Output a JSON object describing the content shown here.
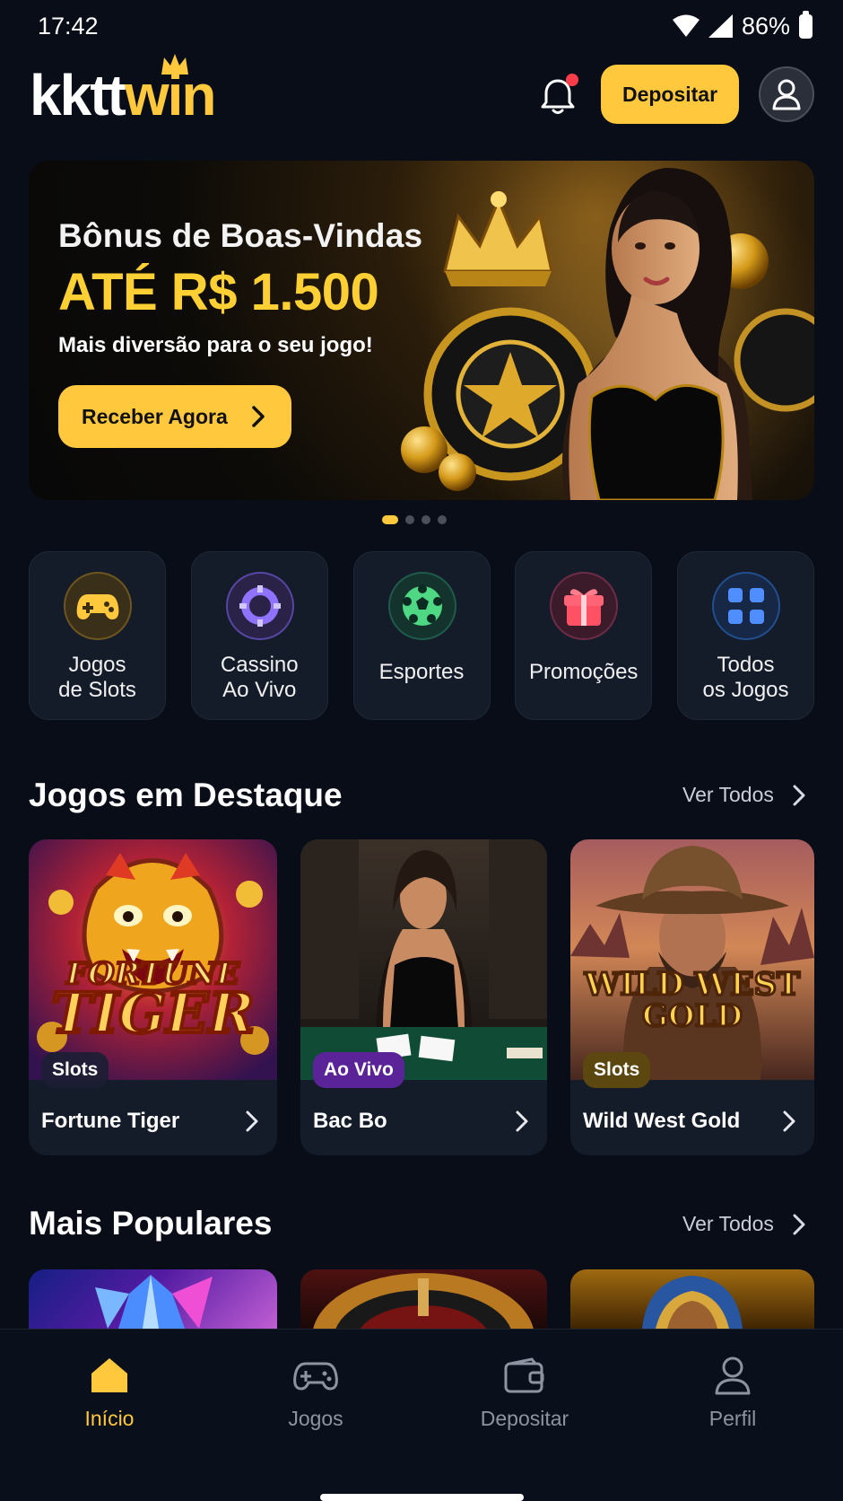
{
  "status_bar": {
    "time": "17:42",
    "battery": "86%"
  },
  "header": {
    "logo_white": "kktt",
    "logo_gold": "win",
    "deposit_label": "Depositar",
    "icons": [
      "bell-icon",
      "user-icon"
    ]
  },
  "banner": {
    "title": "Bônus de Boas-Vindas",
    "amount": "ATÉ R$ 1.500",
    "subtitle": "Mais diversão para o seu jogo!",
    "cta_label": "Receber Agora",
    "slide_count": 4,
    "active_slide": 1
  },
  "quick_links": [
    {
      "line1": "Jogos",
      "line2": "de Slots",
      "icon": "gamepad-icon"
    },
    {
      "line1": "Cassino",
      "line2": "Ao Vivo",
      "icon": "casino-chip-icon"
    },
    {
      "line1": "Esportes",
      "icon": "soccer-ball-icon"
    },
    {
      "line1": "Promoções",
      "icon": "gift-icon"
    },
    {
      "line1": "Todos",
      "line2": "os Jogos",
      "icon": "grid-icon"
    }
  ],
  "featured": {
    "title": "Jogos em Destaque",
    "see_all_label": "Ver Todos",
    "games": [
      {
        "art_title_1": "FORTUNE",
        "art_title_2": "TIGER",
        "tag": "Slots",
        "name": "Fortune Tiger"
      },
      {
        "tag": "Ao Vivo",
        "name": "Bac Bo"
      },
      {
        "art_title_1": "WILD WEST",
        "art_title_2": "GOLD",
        "tag": "Slots",
        "name": "Wild West Gold"
      }
    ]
  },
  "popular": {
    "title": "Mais Populares",
    "see_all_label": "Ver Todos"
  },
  "bottom_nav": {
    "items": [
      {
        "label": "Início",
        "icon": "home-icon",
        "active": true
      },
      {
        "label": "Jogos",
        "icon": "gamepad-icon",
        "active": false
      },
      {
        "label": "Depositar",
        "icon": "wallet-icon",
        "active": false
      },
      {
        "label": "Perfil",
        "icon": "user-icon",
        "active": false
      }
    ]
  },
  "colors": {
    "background": "#080d18",
    "accent": "#ffc83d",
    "card": "#141b29",
    "nav_inactive": "#8d93a0"
  }
}
